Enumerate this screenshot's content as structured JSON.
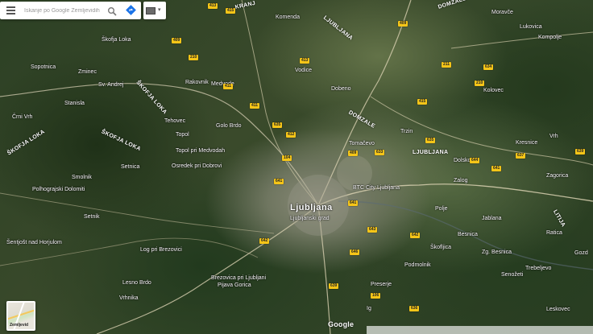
{
  "search": {
    "placeholder": "Iskanje po Google Zemljevidih",
    "menu_icon": "hamburger-menu-icon",
    "search_icon": "magnifier-icon",
    "directions_icon": "directions-icon"
  },
  "layers": {
    "icon": "layers-toggle-icon"
  },
  "minimap": {
    "label": "Zemljevid"
  },
  "logo": {
    "text": "Google"
  },
  "footer": {
    "items": [
      "",
      "",
      "",
      "",
      ""
    ]
  },
  "places": {
    "city": "Ljubljana",
    "ljubljana_grad": "Ljubljanski grad",
    "btc_city": "BTC City Ljubljana",
    "skofja_loka": "Škofja Loka",
    "medvode": "Medvode",
    "kranj": "KRANJ",
    "domzale": "DOMŽALE",
    "domzale2": "DOMZALE",
    "ljubljana_n": "LJUBLJANA",
    "ljubljana_e": "LJUBLJANA",
    "litija": "LITIJA",
    "skofja_loka_r1": "ŠKOFJA LOKA",
    "skofja_loka_r2": "ŠKOFJA LOKA",
    "skofja_loka_r3": "ŠKOFJA LOKA",
    "zg_pirniče": "Topol pri Medvodah",
    "osredek": "Osredek pri Dobrovi",
    "polhograjski": "Polhograjski Dolomiti",
    "sentjost": "Šentjošt nad Horjulom",
    "smolnik": "Smolnik",
    "setnik": "Setnik",
    "log": "Log pri Brezovici",
    "brezovica": "Brezovica pri Ljubljani",
    "ig": "Ig",
    "skofljica": "Škofljica",
    "rakovnik": "Rakovnik",
    "zalog": "Zalog",
    "dobeno": "Dobeno",
    "trzin": "Trzin",
    "vodice": "Vodice",
    "komenda": "Komenda",
    "tomacevo": "Tomačevo",
    "polje": "Polje",
    "besnica": "Besnica",
    "podmolnik": "Podmolnik",
    "zgornja_besnica": "Zg. Besnica",
    "dolsko": "Dolsko",
    "kresnice": "Kresnice",
    "vrhnika": "Vrhnika",
    "lesno_brdo": "Lesno Brdo",
    "sv_andrej": "Sv. Andrej",
    "zminec": "Zminec",
    "stanislav": "Stanisla",
    "sopotnica": "Sopotnica",
    "crni_vrh": "Črni Vrh",
    "setnica": "Setnica",
    "topol": "Topol",
    "golo_brdo": "Golo Brdo",
    "tehovec": "Tehovec",
    "moravce": "Moravče",
    "lukovica": "Lukovica",
    "kompolje": "Kompolje",
    "kolovec": "Kolovec",
    "vrh": "Vrh",
    "zagorica": "Zagorica",
    "jablana": "Jablana",
    "senozeti": "Senožeti",
    "preserje": "Preserje",
    "pijava_gorica": "Pijava Gorica",
    "ratica": "Ratica",
    "lesko": "Leskovec",
    "gozd": "Gozd",
    "trebelno": "Trebeljevo"
  },
  "shields": [
    "413",
    "409",
    "210",
    "411",
    "635",
    "412",
    "409",
    "415",
    "104",
    "641",
    "641",
    "643",
    "646",
    "639",
    "106",
    "635",
    "642",
    "644",
    "637",
    "211",
    "210",
    "634",
    "639",
    "636",
    "641",
    "411",
    "415",
    "413",
    "409",
    "633",
    "642"
  ]
}
